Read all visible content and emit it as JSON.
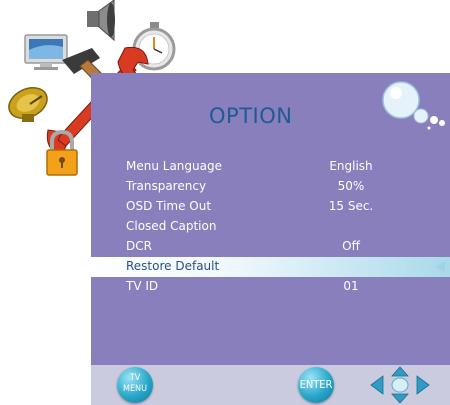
{
  "osd": {
    "title": "OPTION",
    "items": [
      {
        "label": "Menu Language",
        "value": "English"
      },
      {
        "label": "Transparency",
        "value": "50%"
      },
      {
        "label": "OSD Time Out",
        "value": "15 Sec."
      },
      {
        "label": "Closed Caption",
        "value": ""
      },
      {
        "label": "DCR",
        "value": "Off"
      },
      {
        "label": "Restore Default",
        "value": ""
      },
      {
        "label": "TV ID",
        "value": "01"
      }
    ],
    "selected_index": 5
  },
  "buttons": {
    "menu_line1": "TV",
    "menu_line2": "MENU",
    "enter": "ENTER"
  },
  "colors": {
    "panel": "#8a7fbd",
    "title": "#1e5b93",
    "bar": "#cbcbe0",
    "button": "#27a6c8",
    "highlight": "#a9d9ea"
  },
  "icons": [
    "monitor-icon",
    "speaker-icon",
    "stopwatch-icon",
    "hammer-wrench-icon",
    "satellite-dish-icon",
    "padlock-icon",
    "bubbles-icon",
    "dpad-icon"
  ]
}
